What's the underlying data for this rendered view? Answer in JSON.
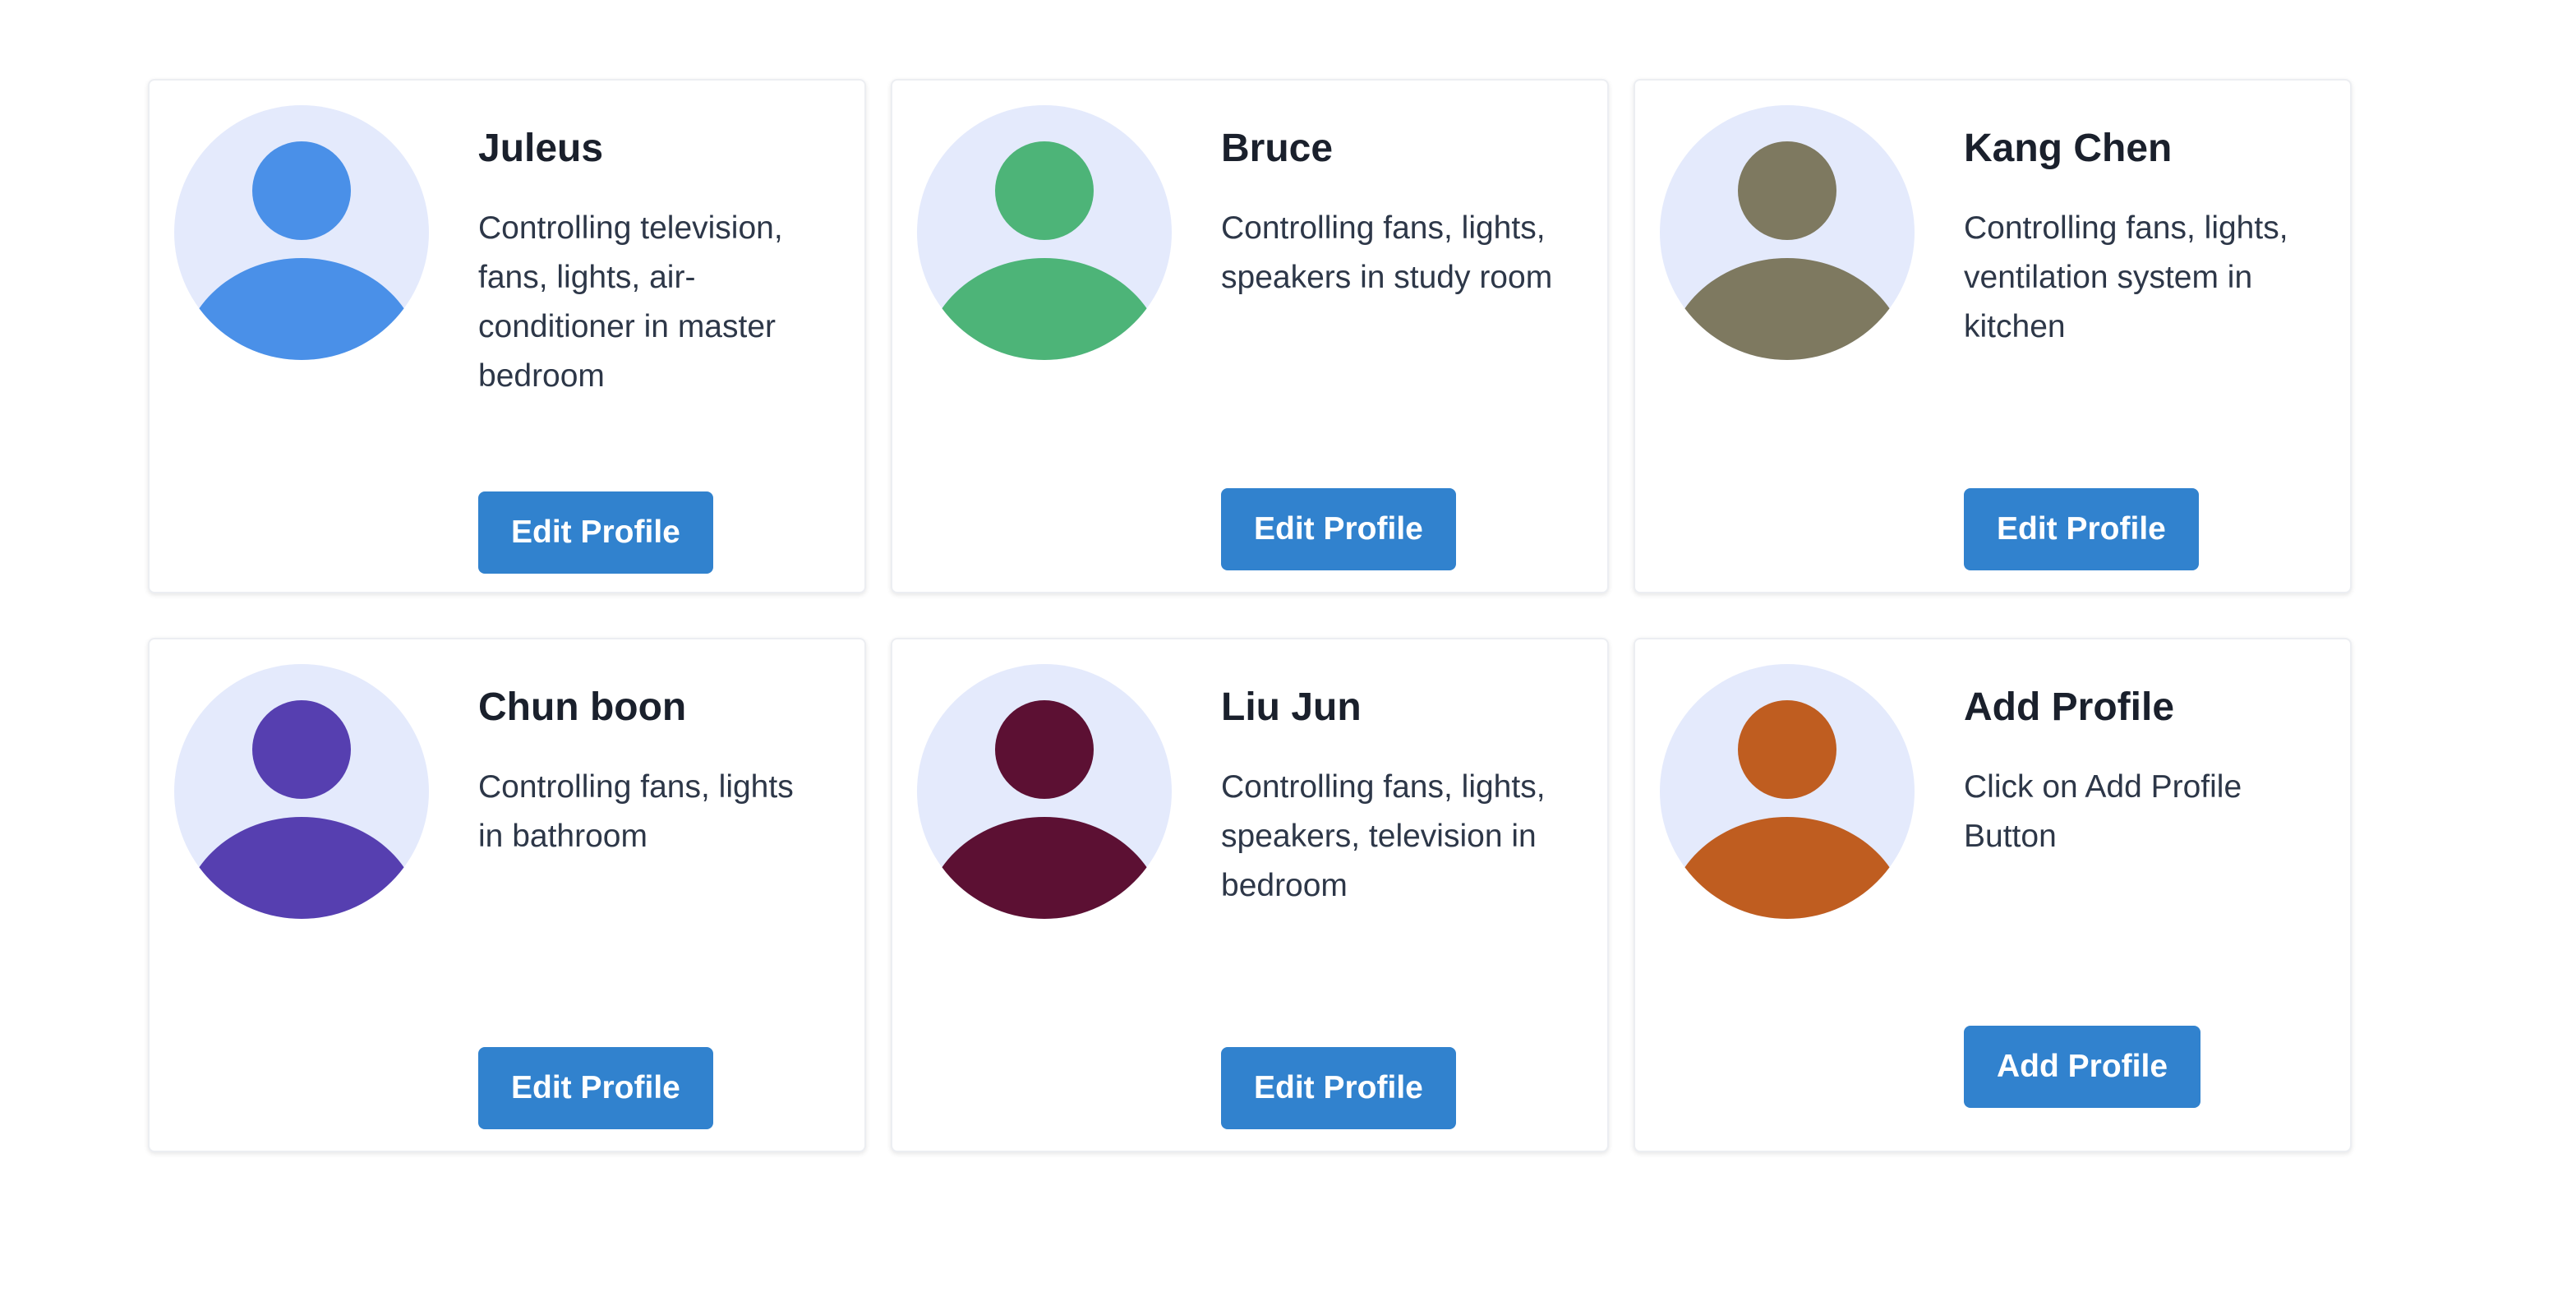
{
  "colors": {
    "avatar_bg": "#e4eafc",
    "button": "#3182ce"
  },
  "profiles": [
    {
      "name": "Juleus",
      "description": "Controlling television, fans, lights, air-conditioner in master bedroom",
      "button_label": "Edit Profile",
      "avatar_color": "#4a90e8",
      "avatar_icon": "user-icon"
    },
    {
      "name": "Bruce",
      "description": "Controlling fans, lights, speakers in study room",
      "button_label": "Edit Profile",
      "avatar_color": "#4db478",
      "avatar_icon": "user-icon"
    },
    {
      "name": "Kang Chen",
      "description": "Controlling fans, lights, ventilation system in kitchen",
      "button_label": "Edit Profile",
      "avatar_color": "#7e7960",
      "avatar_icon": "user-icon"
    },
    {
      "name": "Chun boon",
      "description": "Controlling fans, lights in bathroom",
      "button_label": "Edit Profile",
      "avatar_color": "#563fb0",
      "avatar_icon": "user-icon"
    },
    {
      "name": "Liu Jun",
      "description": "Controlling fans, lights, speakers, television in bedroom",
      "button_label": "Edit Profile",
      "avatar_color": "#5c1033",
      "avatar_icon": "user-icon"
    },
    {
      "name": "Add Profile",
      "description": "Click on Add Profile Button",
      "button_label": "Add Profile",
      "avatar_color": "#bf5d20",
      "avatar_icon": "user-icon"
    }
  ]
}
